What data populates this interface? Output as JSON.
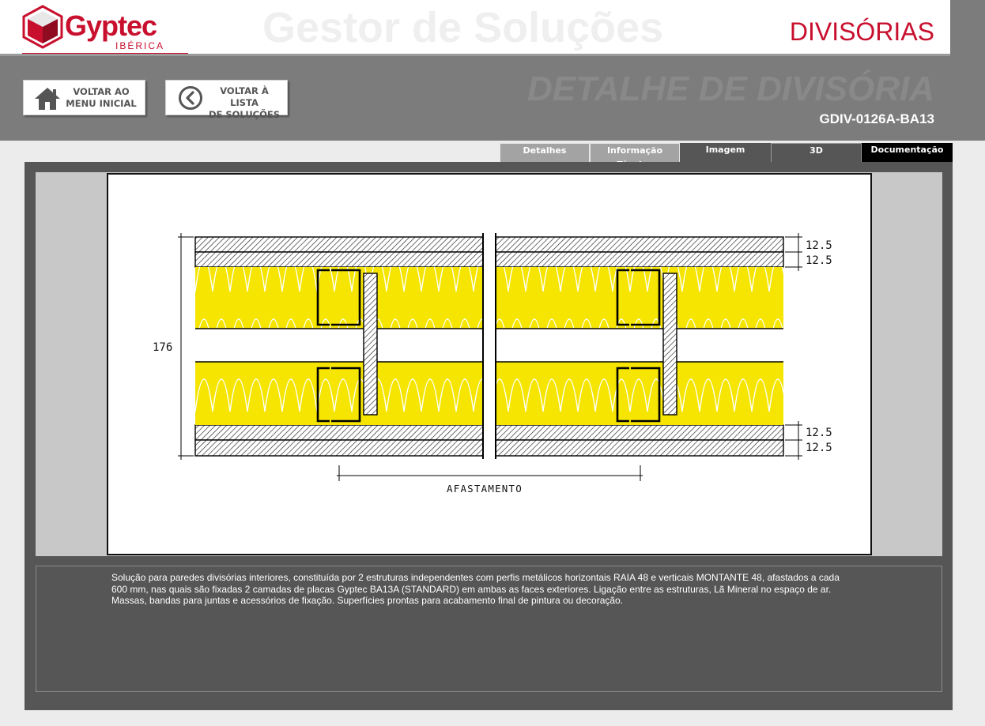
{
  "brand": {
    "name": "Gyptec",
    "sub": "IBÉRICA",
    "colors": {
      "primary": "#c8102e",
      "header_band": "#7c7c7c",
      "panel": "#565656"
    }
  },
  "header": {
    "watermark_title": "Gestor de Soluções",
    "section_title": "DIVISÓRIAS",
    "page_subtitle": "DETALHE DE DIVISÓRIA",
    "solution_code": "GDIV-0126A-BA13"
  },
  "nav": {
    "home_label": "VOLTAR AO\nMENU INICIAL",
    "home_icon": "home-icon",
    "back_label": "VOLTAR À LISTA\nDE SOLUÇÕES",
    "back_icon": "chevron-left-circle-icon"
  },
  "tabs": [
    {
      "label": "Detalhes",
      "state": "inactive"
    },
    {
      "label": "Informação Técnica",
      "state": "inactive"
    },
    {
      "label": "Imagem",
      "state": "active"
    },
    {
      "label": "3D",
      "state": "inactive"
    },
    {
      "label": "Documentação",
      "state": "dark"
    }
  ],
  "drawing": {
    "dimension_labels": [
      "12.5",
      "12.5",
      "12.5",
      "12.5"
    ],
    "total_thickness": "176",
    "spacing_label": "AFASTAMENTO",
    "insulation_color": "#f5e500"
  },
  "description": "Solução para paredes divisórias interiores, constituída por 2 estruturas independentes com perfis metálicos horizontais RAIA 48 e verticais MONTANTE 48, afastados a cada 600 mm, nas quais são fixadas 2 camadas de placas Gyptec BA13A (STANDARD) em ambas as faces exteriores. Ligação entre as estruturas, Lã Mineral no espaço de ar.  Massas, bandas para juntas e acessórios de fixação. Superfícies prontas para acabamento final de pintura ou decoração."
}
